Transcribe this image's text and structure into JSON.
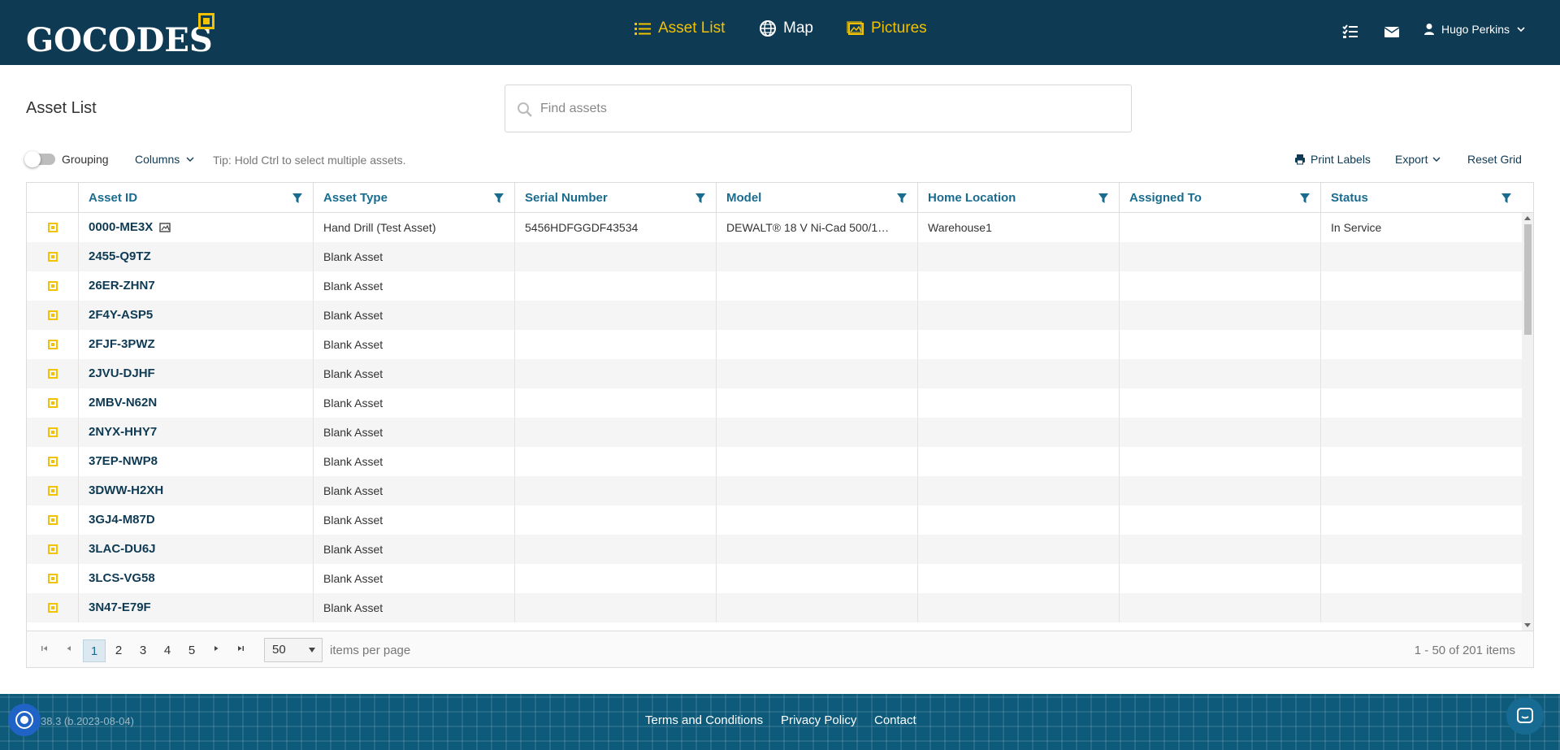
{
  "header": {
    "logo_text": "GOCODES",
    "nav": [
      {
        "label": "Asset List",
        "icon": "list-icon"
      },
      {
        "label": "Map",
        "icon": "globe-icon"
      },
      {
        "label": "Pictures",
        "icon": "image-icon"
      }
    ],
    "user_name": "Hugo Perkins"
  },
  "toolbar": {
    "page_title": "Asset List",
    "search_placeholder": "Find assets",
    "grouping_label": "Grouping",
    "grouping_enabled": false,
    "columns_label": "Columns",
    "tip": "Tip: Hold Ctrl to select multiple assets.",
    "print_labels": "Print Labels",
    "export": "Export",
    "reset_grid": "Reset Grid"
  },
  "grid": {
    "columns": [
      "Asset ID",
      "Asset Type",
      "Serial Number",
      "Model",
      "Home Location",
      "Assigned To",
      "Status"
    ],
    "rows": [
      {
        "id": "0000-ME3X",
        "type": "Hand Drill (Test Asset)",
        "serial": "5456HDFGGDF43534",
        "model": "DEWALT® 18 V Ni-Cad 500/1…",
        "home": "Warehouse1",
        "assigned": "",
        "status": "In Service",
        "has_picture": true
      },
      {
        "id": "2455-Q9TZ",
        "type": "Blank Asset",
        "serial": "",
        "model": "",
        "home": "",
        "assigned": "",
        "status": ""
      },
      {
        "id": "26ER-ZHN7",
        "type": "Blank Asset",
        "serial": "",
        "model": "",
        "home": "",
        "assigned": "",
        "status": ""
      },
      {
        "id": "2F4Y-ASP5",
        "type": "Blank Asset",
        "serial": "",
        "model": "",
        "home": "",
        "assigned": "",
        "status": ""
      },
      {
        "id": "2FJF-3PWZ",
        "type": "Blank Asset",
        "serial": "",
        "model": "",
        "home": "",
        "assigned": "",
        "status": ""
      },
      {
        "id": "2JVU-DJHF",
        "type": "Blank Asset",
        "serial": "",
        "model": "",
        "home": "",
        "assigned": "",
        "status": ""
      },
      {
        "id": "2MBV-N62N",
        "type": "Blank Asset",
        "serial": "",
        "model": "",
        "home": "",
        "assigned": "",
        "status": ""
      },
      {
        "id": "2NYX-HHY7",
        "type": "Blank Asset",
        "serial": "",
        "model": "",
        "home": "",
        "assigned": "",
        "status": ""
      },
      {
        "id": "37EP-NWP8",
        "type": "Blank Asset",
        "serial": "",
        "model": "",
        "home": "",
        "assigned": "",
        "status": ""
      },
      {
        "id": "3DWW-H2XH",
        "type": "Blank Asset",
        "serial": "",
        "model": "",
        "home": "",
        "assigned": "",
        "status": ""
      },
      {
        "id": "3GJ4-M87D",
        "type": "Blank Asset",
        "serial": "",
        "model": "",
        "home": "",
        "assigned": "",
        "status": ""
      },
      {
        "id": "3LAC-DU6J",
        "type": "Blank Asset",
        "serial": "",
        "model": "",
        "home": "",
        "assigned": "",
        "status": ""
      },
      {
        "id": "3LCS-VG58",
        "type": "Blank Asset",
        "serial": "",
        "model": "",
        "home": "",
        "assigned": "",
        "status": ""
      },
      {
        "id": "3N47-E79F",
        "type": "Blank Asset",
        "serial": "",
        "model": "",
        "home": "",
        "assigned": "",
        "status": ""
      }
    ]
  },
  "pager": {
    "pages": [
      "1",
      "2",
      "3",
      "4",
      "5"
    ],
    "current_page": "1",
    "page_size": "50",
    "items_per_page": "items per page",
    "info": "1 - 50 of 201 items"
  },
  "footer": {
    "version": "38.3 (b.2023-08-04)",
    "links": [
      "Terms and Conditions",
      "Privacy Policy",
      "Contact"
    ]
  },
  "colors": {
    "header_bg": "#0e3a54",
    "accent": "#f2c200",
    "link": "#1a6c8f",
    "footer_bg": "#0e5a7a"
  }
}
